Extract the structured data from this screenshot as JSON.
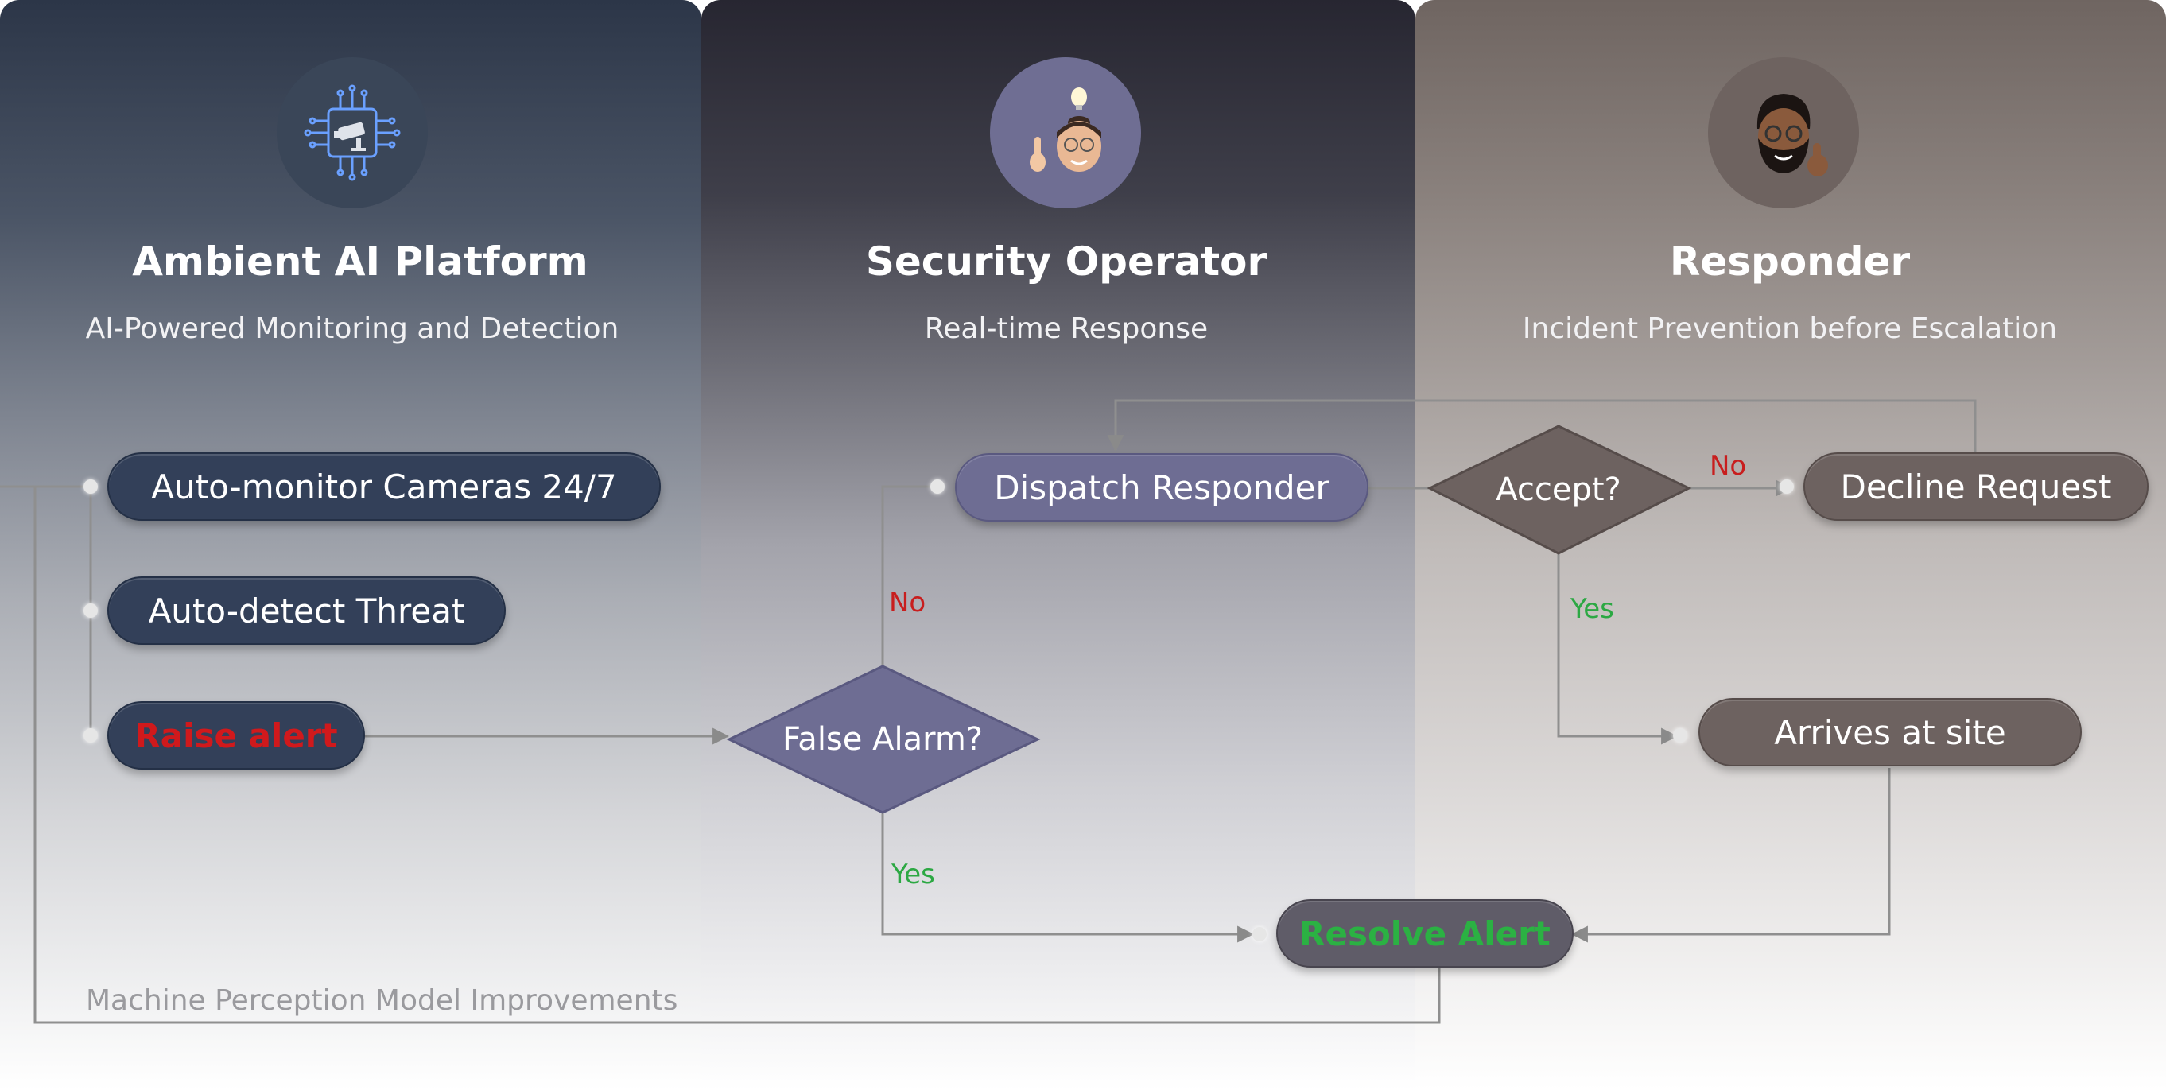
{
  "lanes": [
    {
      "title": "Ambient AI Platform",
      "subtitle": "AI-Powered Monitoring and Detection"
    },
    {
      "title": "Security Operator",
      "subtitle": "Real-time Response"
    },
    {
      "title": "Responder",
      "subtitle": "Incident Prevention before Escalation"
    }
  ],
  "nodes": {
    "monitor": "Auto-monitor Cameras 24/7",
    "detect": "Auto-detect Threat",
    "raise": "Raise alert",
    "false_alarm": "False Alarm?",
    "dispatch": "Dispatch Responder",
    "accept": "Accept?",
    "decline": "Decline Request",
    "arrives": "Arrives at site",
    "resolve": "Resolve Alert"
  },
  "edge_labels": {
    "no_false_alarm": "No",
    "yes_false_alarm": "Yes",
    "no_accept": "No",
    "yes_accept": "Yes"
  },
  "feedback_label": "Machine Perception Model Improvements",
  "icons": [
    "ai-chip-camera-icon",
    "operator-memoji-icon",
    "responder-memoji-icon"
  ],
  "colors": {
    "no": "#c81e1e",
    "yes": "#2ca843",
    "alert": "#d0191c"
  }
}
